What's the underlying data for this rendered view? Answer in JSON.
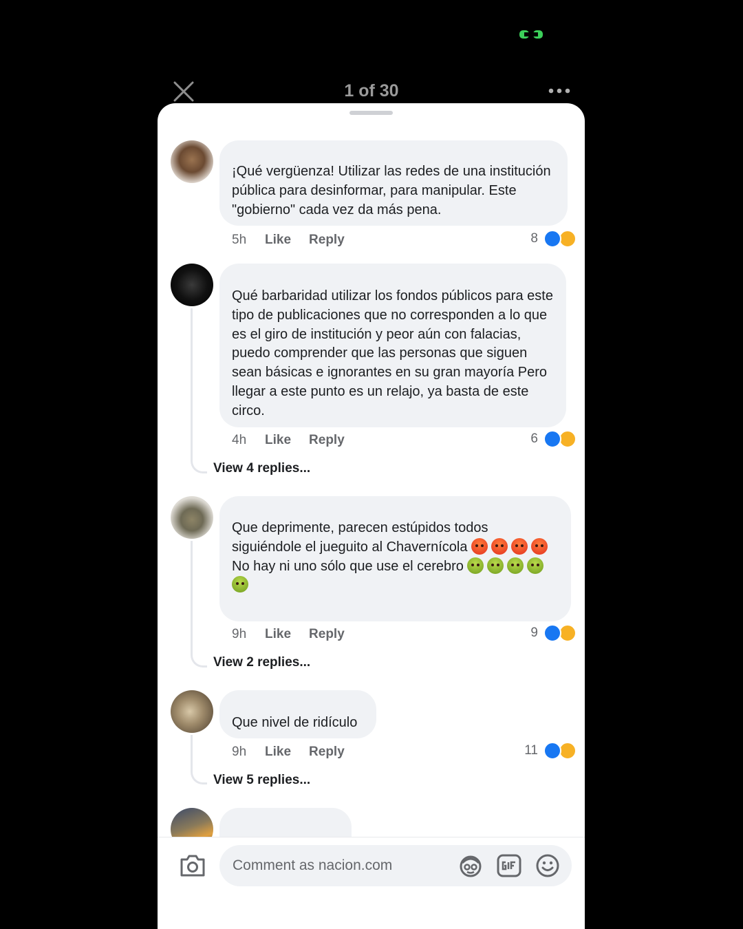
{
  "header": {
    "counter": "1 of 30"
  },
  "actions": {
    "like": "Like",
    "reply": "Reply"
  },
  "colors": {
    "like_blue": "#1877f2",
    "bubble_bg": "#f0f2f5",
    "meta_gray": "#65676b",
    "status_green": "#3ccf5a"
  },
  "comments": [
    {
      "text": "¡Qué vergüenza! Utilizar las redes de una institución pública para desinformar, para manipular. Este \"gobierno\" cada vez da más pena.",
      "time": "5h",
      "reactions": "8"
    },
    {
      "text": "Qué barbaridad utilizar los fondos públicos para este tipo de publicaciones que no corresponden a lo que es el giro de institución y peor aún con falacias, puedo comprender que las personas que siguen sean básicas e ignorantes en su gran mayoría Pero llegar a este punto es un relajo, ya basta de este circo.",
      "time": "4h",
      "reactions": "6",
      "view_replies": "View 4 replies..."
    },
    {
      "text_line1": "Que deprimente, parecen estúpidos todos siguiéndole el jueguito al Chavernícola",
      "text_line2": "No hay ni uno sólo que use el cerebro",
      "emoji_angry": "angry-face-emoji",
      "emoji_sick": "nauseated-face-emoji",
      "time": "9h",
      "reactions": "9",
      "view_replies": "View 2 replies..."
    },
    {
      "text": "Que nivel de ridículo",
      "time": "9h",
      "reactions": "11",
      "view_replies": "View 5 replies..."
    }
  ],
  "composer": {
    "placeholder": "Comment as nacion.com",
    "icons": [
      "camera-icon",
      "avatar-sticker-icon",
      "gif-icon",
      "emoji-icon"
    ]
  }
}
